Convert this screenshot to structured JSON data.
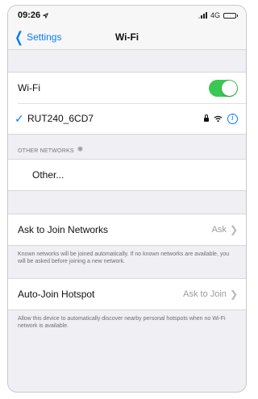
{
  "status": {
    "time": "09:26",
    "network": "4G"
  },
  "nav": {
    "back_label": "Settings",
    "title": "Wi-Fi"
  },
  "wifi": {
    "label": "Wi-Fi",
    "enabled": true,
    "connected_network": "RUT240_6CD7"
  },
  "other_networks": {
    "header": "OTHER NETWORKS",
    "other_label": "Other..."
  },
  "ask_to_join": {
    "label": "Ask to Join Networks",
    "value": "Ask",
    "footer": "Known networks will be joined automatically. If no known networks are available, you will be asked before joining a new network."
  },
  "auto_join_hotspot": {
    "label": "Auto-Join Hotspot",
    "value": "Ask to Join",
    "footer": "Allow this device to automatically discover nearby personal hotspots when no Wi-Fi network is available."
  },
  "colors": {
    "accent": "#0a7aff",
    "toggle_on": "#3bc753",
    "background": "#efeff4"
  },
  "icons": {
    "location": "location-arrow-icon",
    "back": "chevron-left-icon",
    "check": "checkmark-icon",
    "lock": "lock-icon",
    "wifi": "wifi-icon",
    "info": "info-icon",
    "disclosure": "chevron-right-icon",
    "spinner": "spinner-icon"
  }
}
